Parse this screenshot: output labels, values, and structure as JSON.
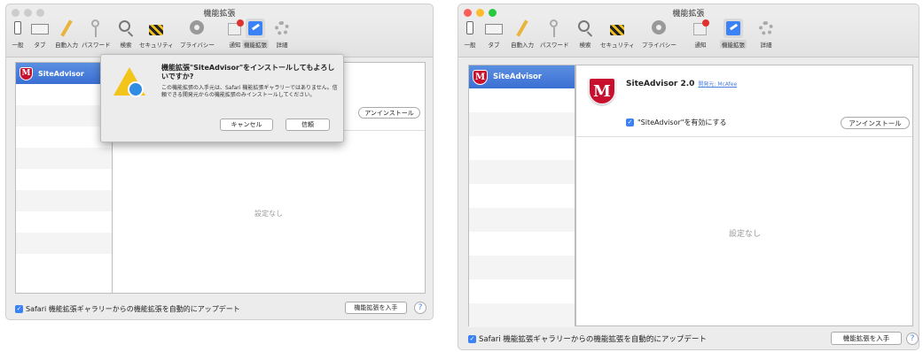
{
  "window_title": "機能拡張",
  "toolbar": [
    {
      "label": "一般",
      "icon": "switch-icon"
    },
    {
      "label": "タブ",
      "icon": "tabs-icon"
    },
    {
      "label": "自動入力",
      "icon": "pencil-icon"
    },
    {
      "label": "パスワード",
      "icon": "key-icon"
    },
    {
      "label": "検索",
      "icon": "search-icon"
    },
    {
      "label": "セキュリティ",
      "icon": "security-icon"
    },
    {
      "label": "プライバシー",
      "icon": "privacy-icon"
    },
    {
      "label": "通知",
      "icon": "notification-icon"
    },
    {
      "label": "機能拡張",
      "icon": "extensions-icon"
    },
    {
      "label": "詳細",
      "icon": "gear-icon"
    }
  ],
  "extension": {
    "name": "SiteAdvisor",
    "version_title": "SiteAdvisor 2.0",
    "developer": "開発元: McAfee",
    "enable_label": "\"SiteAdvisor\"を有効にする",
    "uninstall": "アンインストール",
    "none": "設定なし"
  },
  "dialog": {
    "title": "機能拡張\"SiteAdvisor\"をインストールしてもよろしいですか?",
    "body": "この機能拡張の入手元は、Safari 機能拡張ギャラリーではありません。信頼できる開発元からの機能拡張のみインストールしてください。",
    "cancel": "キャンセル",
    "trust": "信頼"
  },
  "footer": {
    "auto_update": "Safari 機能拡張ギャラリーからの機能拡張を自動的にアップデート",
    "get_button": "機能拡張を入手",
    "help": "?"
  },
  "colors": {
    "accent": "#3b82f6",
    "mcafee_red": "#c8102e",
    "selection": "#4a7fe0"
  }
}
